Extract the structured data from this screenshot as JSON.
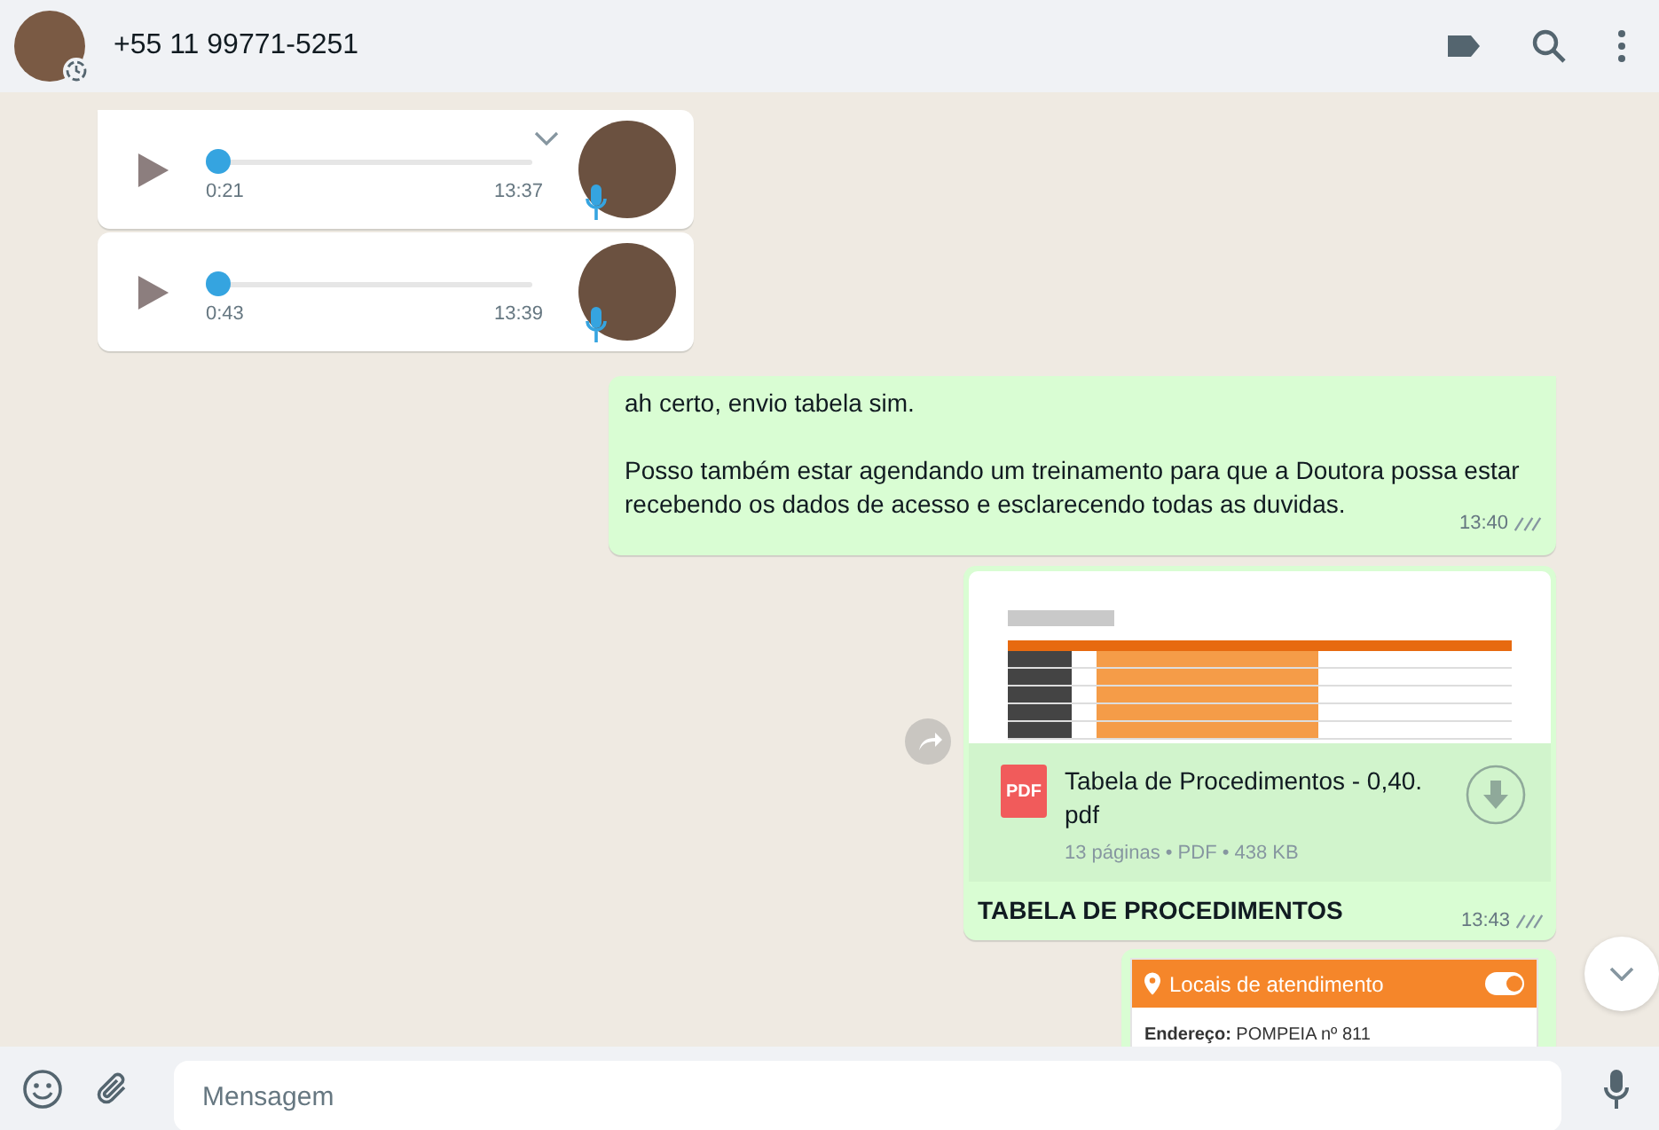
{
  "header": {
    "contact": "+55 11 99771-5251"
  },
  "messages": [
    {
      "kind": "audio",
      "incoming": true,
      "tail": true,
      "menu_shown": true,
      "level": 0,
      "duration": "0:21",
      "time": "13:37"
    },
    {
      "kind": "audio",
      "incoming": true,
      "tail": false,
      "menu_shown": false,
      "level": 0,
      "duration": "0:43",
      "time": "13:39"
    },
    {
      "kind": "text",
      "incoming": false,
      "tail": true,
      "paragraphs": [
        "ah certo, envio tabela sim.",
        "Posso também estar agendando um treinamento para que a Doutora possa estar recebendo os dados de acesso e esclarecendo todas as duvidas."
      ],
      "time": "13:40",
      "read": false
    },
    {
      "kind": "document",
      "incoming": false,
      "tail": false,
      "file_type": "PDF",
      "file_name": "Tabela de Procedimentos - 0,40.pdf",
      "meta": "13 páginas • PDF • 438 KB",
      "caption": "TABELA DE PROCEDIMENTOS",
      "time": "13:43",
      "read": false
    },
    {
      "kind": "image",
      "incoming": false,
      "tail": false,
      "card": {
        "title": "Locais de atendimento",
        "toggle_on": true,
        "fields": [
          {
            "label": "Endereço:",
            "value": "POMPEIA nº 811"
          }
        ]
      }
    }
  ],
  "composer": {
    "placeholder": "Mensagem"
  }
}
